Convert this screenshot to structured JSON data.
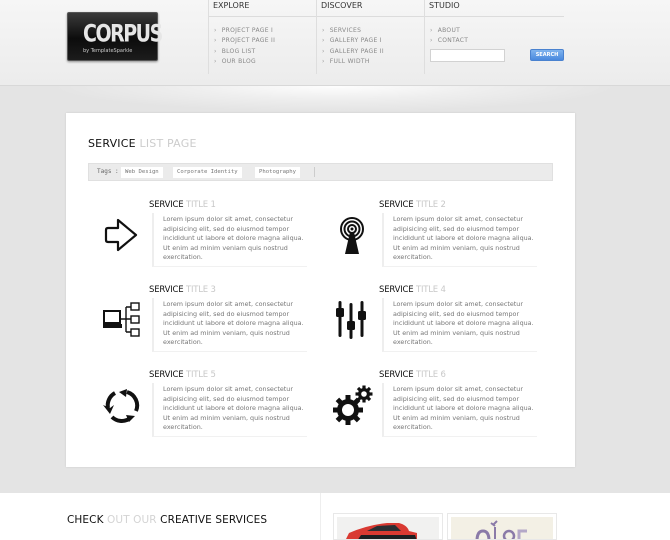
{
  "logo": {
    "title": "CORPUS",
    "subtitle": "by TemplateSparkle"
  },
  "nav": {
    "columns": [
      {
        "heading": "EXPLORE",
        "items": [
          "PROJECT PAGE I",
          "PROJECT PAGE II",
          "BLOG LIST",
          "OUR BLOG"
        ]
      },
      {
        "heading": "DISCOVER",
        "items": [
          "SERVICES",
          "GALLERY PAGE I",
          "GALLERY PAGE II",
          "FULL WIDTH"
        ]
      },
      {
        "heading": "STUDIO",
        "items": [
          "ABOUT",
          "CONTACT"
        ]
      }
    ],
    "search": {
      "value": "",
      "placeholder": "",
      "button_label": "SEARCH"
    }
  },
  "main": {
    "title_dark": "SERVICE",
    "title_light": "LIST PAGE",
    "tags_label": "Tags :",
    "tags": [
      "Web Design",
      "Corporate Identity",
      "Photography"
    ],
    "services": [
      {
        "title_dark": "SERVICE",
        "title_light": "TITLE 1",
        "icon": "arrow-right-icon",
        "body": "Lorem ipsum dolor sit amet, consectetur adipisicing elit, sed do eiusmod tempor incididunt ut labore et dolore magna aliqua. Ut enim ad minim veniam quis nostrud exercitation."
      },
      {
        "title_dark": "SERVICE",
        "title_light": "TITLE 2",
        "icon": "broadcast-tower-icon",
        "body": "Lorem ipsum dolor sit amet, consectetur adipisicing elit, sed do eiusmod tempor incididunt ut labore et dolore magna aliqua. Ut enim ad minim veniam, quis nostrud exercitation."
      },
      {
        "title_dark": "SERVICE",
        "title_light": "TITLE 3",
        "icon": "network-computer-icon",
        "body": "Lorem ipsum dolor sit amet, consectetur adipisicing elit, sed do eiusmod tempor incididunt ut labore et dolore magna aliqua. Ut enim ad minim veniam, quis nostrud exercitation."
      },
      {
        "title_dark": "SERVICE",
        "title_light": "TITLE 4",
        "icon": "sliders-icon",
        "body": "Lorem ipsum dolor sit amet, consectetur adipisicing elit, sed do eiusmod tempor incididunt ut labore et dolore magna aliqua. Ut enim ad minim veniam, quis nostrud exercitation."
      },
      {
        "title_dark": "SERVICE",
        "title_light": "TITLE 5",
        "icon": "refresh-cycle-icon",
        "body": "Lorem ipsum dolor sit amet, consectetur adipisicing elit, sed do eiusmod tempor incididunt ut labore et dolore magna aliqua. Ut enim ad minim veniam, quis nostrud exercitation."
      },
      {
        "title_dark": "SERVICE",
        "title_light": "TITLE 6",
        "icon": "gears-icon",
        "body": "Lorem ipsum dolor sit amet, consectetur adipisicing elit, sed do eiusmod tempor incididunt ut labore et dolore magna aliqua. Ut enim ad minim veniam, quis nostrud exercitation."
      }
    ]
  },
  "bottom": {
    "heading": [
      {
        "text": "CHECK",
        "tone": "dark"
      },
      {
        "text": "OUT OUR",
        "tone": "light"
      },
      {
        "text": "CREATIVE SERVICES",
        "tone": "dark"
      }
    ],
    "thumbnails": [
      "red-car-thumbnail",
      "illustration-thumbnail"
    ]
  },
  "colors": {
    "accent": "#4a89de",
    "background": "#e4e4e4",
    "panel": "#ffffff"
  }
}
